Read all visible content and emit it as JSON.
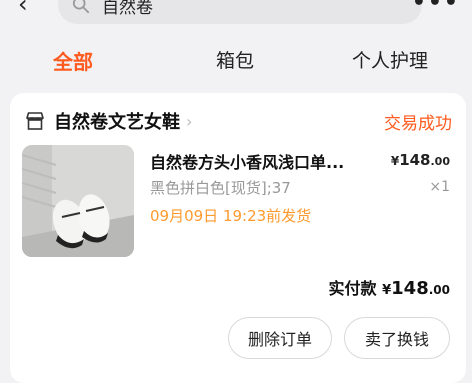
{
  "header": {
    "search_text": "自然卷"
  },
  "tabs": [
    {
      "label": "全部",
      "active": true
    },
    {
      "label": "箱包",
      "active": false
    },
    {
      "label": "个人护理",
      "active": false
    }
  ],
  "order": {
    "shop_name": "自然卷文艺女鞋",
    "status": "交易成功",
    "item": {
      "title": "自然卷方头小香风浅口单...",
      "price_currency": "¥",
      "price_int": "148",
      "price_dec": ".00",
      "sku": "黑色拼白色[现货];37",
      "qty": "×1",
      "ship_note": "09月09日 19:23前发货"
    },
    "paid_label": "实付款",
    "paid_currency": "¥",
    "paid_int": "148",
    "paid_dec": ".00",
    "actions": {
      "delete": "删除订单",
      "resell": "卖了换钱"
    }
  },
  "colors": {
    "accent": "#ff5a1f",
    "ship_note": "#ff9a2e"
  }
}
